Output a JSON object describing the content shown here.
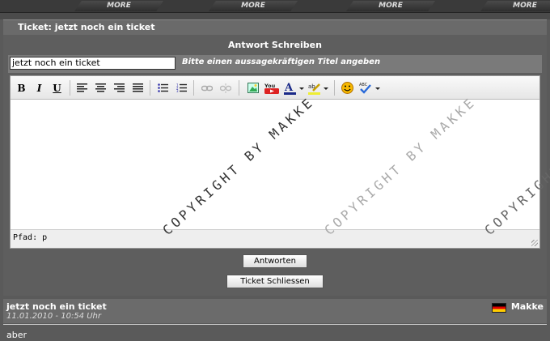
{
  "nav": {
    "more_labels": [
      "MORE",
      "MORE",
      "MORE",
      "MORE"
    ]
  },
  "ticket_title": "Ticket: jetzt noch ein ticket",
  "reply": {
    "heading": "Antwort Schreiben",
    "title_value": "jetzt noch ein ticket",
    "title_hint": "Bitte einen aussagekräftigen Titel angeben"
  },
  "editor": {
    "status_path": "Pfad: p",
    "toolbar_icons": [
      "bold-icon",
      "italic-icon",
      "underline-icon",
      "align-left-icon",
      "align-center-icon",
      "align-right-icon",
      "align-justify-icon",
      "bullet-list-icon",
      "numbered-list-icon",
      "link-icon",
      "unlink-icon",
      "image-icon",
      "youtube-icon",
      "font-color-icon",
      "highlight-icon",
      "smiley-icon",
      "spellcheck-icon"
    ],
    "bold_glyph": "B",
    "italic_glyph": "I",
    "underline_glyph": "U",
    "youtube_text": "You"
  },
  "buttons": {
    "reply_label": "Antworten",
    "close_label": "Ticket Schliessen"
  },
  "post": {
    "title": "jetzt noch ein ticket",
    "date": "11.01.2010 - 10:54 Uhr",
    "user": "Makke",
    "body": "aber"
  },
  "watermark": {
    "text": "COPYRIGHT BY MAKKE"
  },
  "colors": {
    "accent": "#5a5a5a",
    "panel": "#6a6a6a"
  }
}
